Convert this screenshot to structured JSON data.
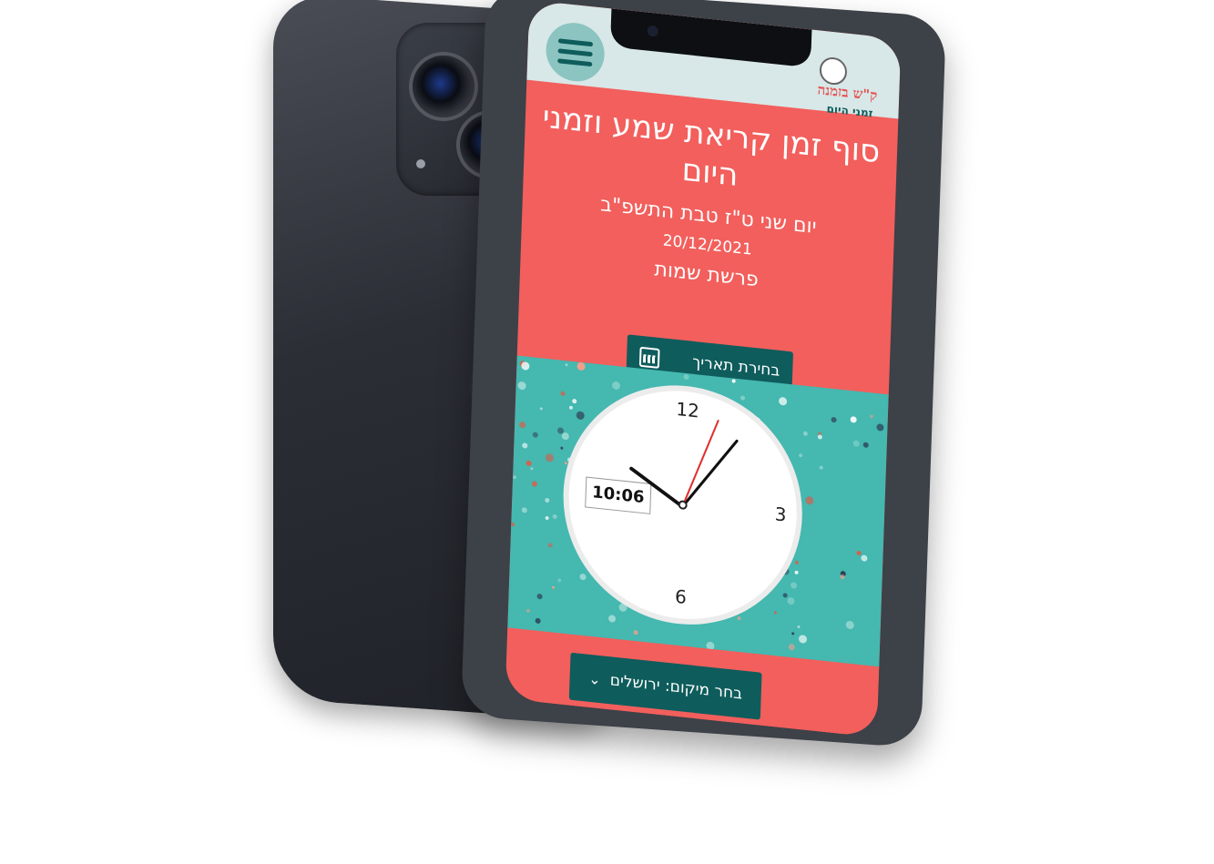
{
  "app": {
    "logo_text": "ק\"ש בזמנה",
    "logo_subtitle": "זמני היום"
  },
  "hero": {
    "title": "סוף זמן קריאת שמע וזמני היום",
    "hebrew_date": "יום שני ט\"ז טבת התשפ\"ב",
    "gregorian_date": "20/12/2021",
    "parasha": "פרשת שמות",
    "date_button_label": "בחירת תאריך"
  },
  "clock": {
    "digital_time": "10:06",
    "numbers": [
      "12",
      "3",
      "6"
    ]
  },
  "location": {
    "button_label": "בחר מיקום: ירושלים"
  },
  "colors": {
    "accent": "#f25f5c",
    "primary": "#0f5c5c",
    "header_bg": "#d8e7e7",
    "clock_bg": "#45b8b0"
  },
  "icons": [
    "menu-icon",
    "calendar-icon",
    "chevron-down-icon",
    "apple-logo-icon"
  ]
}
